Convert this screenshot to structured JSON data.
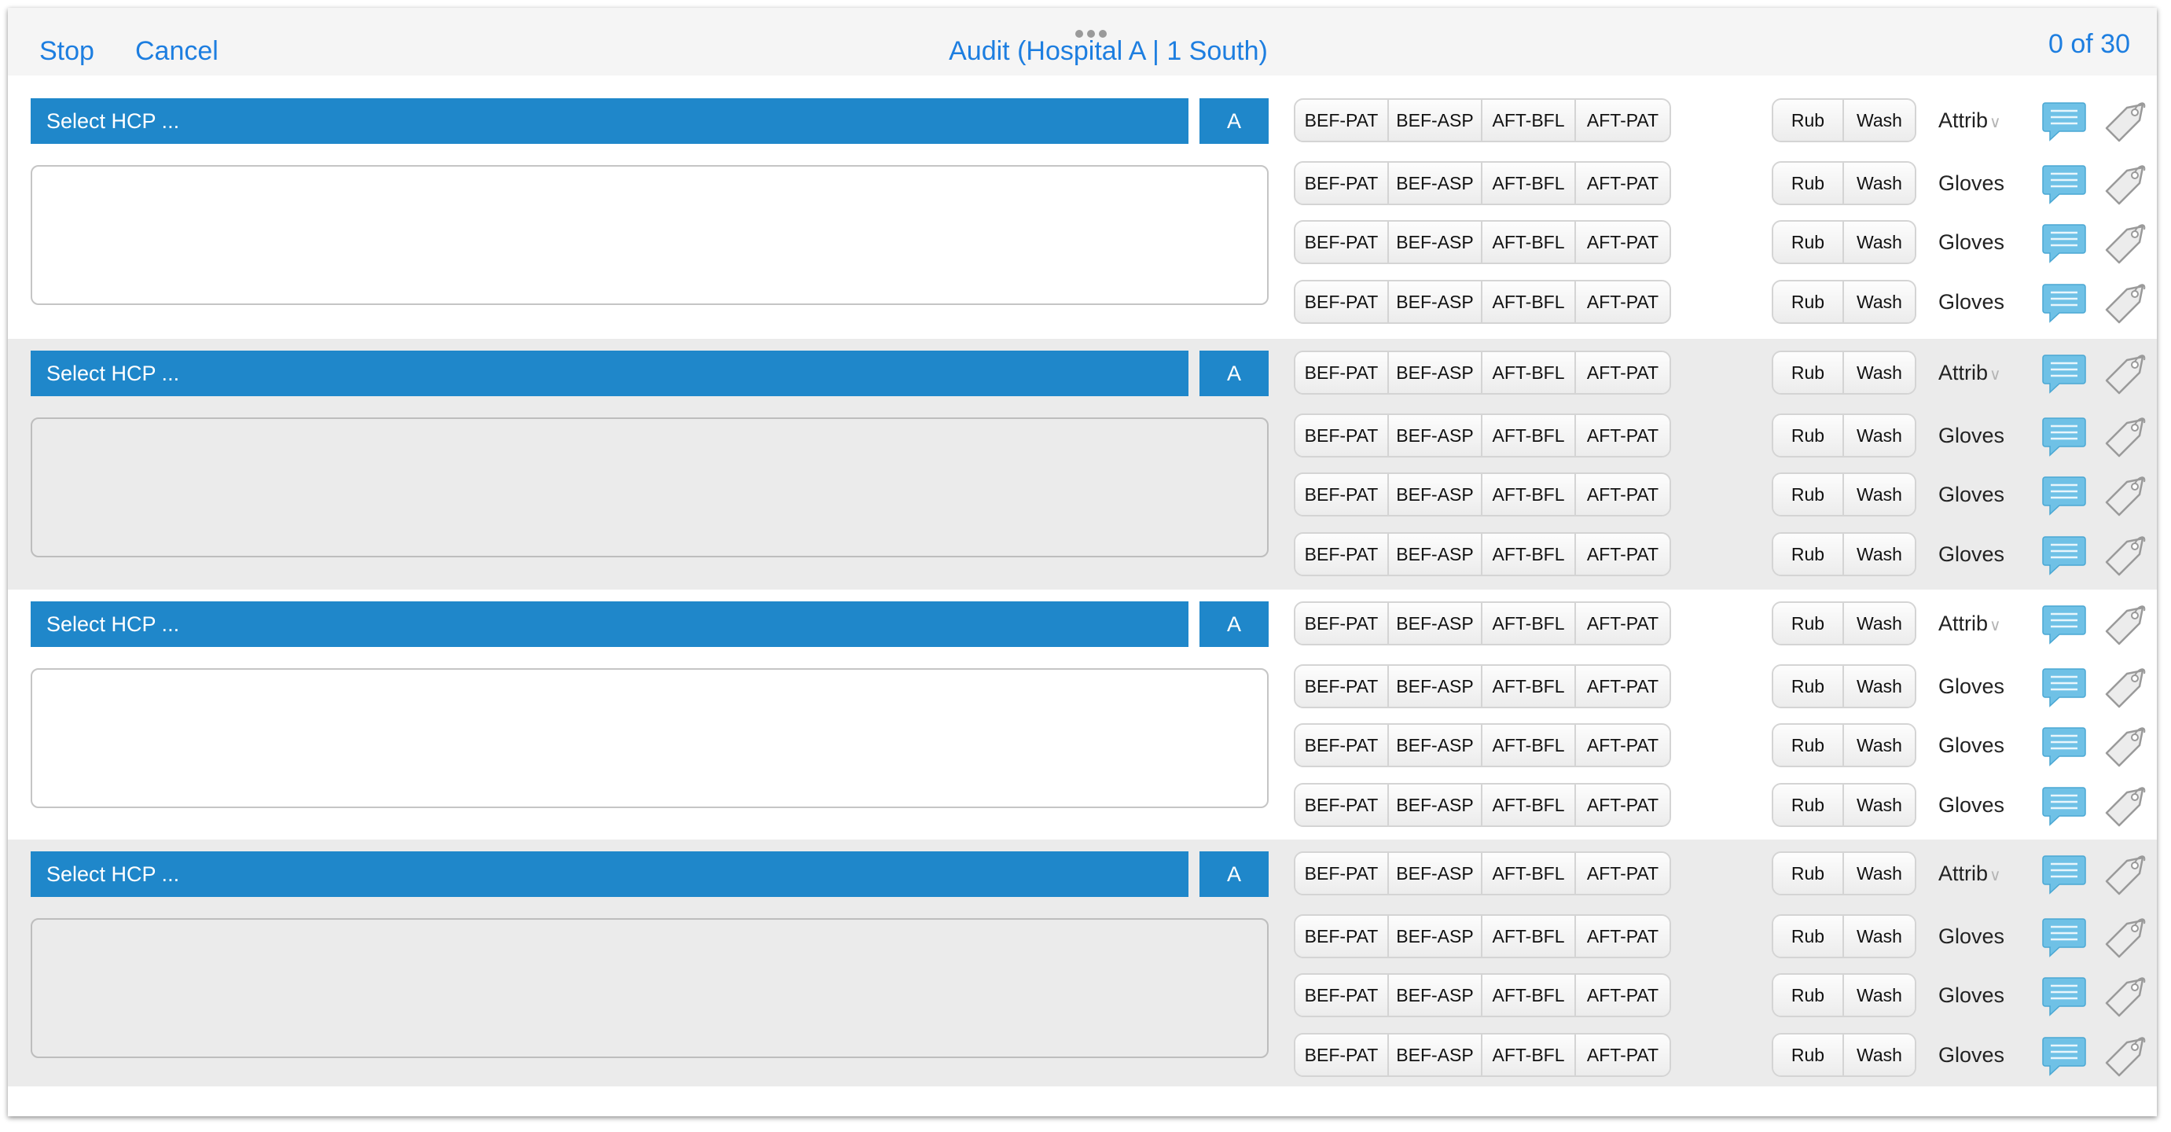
{
  "header": {
    "stop": "Stop",
    "cancel": "Cancel",
    "title": "Audit (Hospital A | 1 South)",
    "counter": "0 of 30"
  },
  "groups": [
    {
      "hcp_placeholder": "Select HCP ...",
      "a_label": "A",
      "rows": [
        {
          "moments": [
            "BEF-PAT",
            "BEF-ASP",
            "AFT-BFL",
            "AFT-PAT"
          ],
          "hygiene": [
            "Rub",
            "Wash"
          ],
          "type": "Attrib"
        },
        {
          "moments": [
            "BEF-PAT",
            "BEF-ASP",
            "AFT-BFL",
            "AFT-PAT"
          ],
          "hygiene": [
            "Rub",
            "Wash"
          ],
          "type": "Gloves"
        },
        {
          "moments": [
            "BEF-PAT",
            "BEF-ASP",
            "AFT-BFL",
            "AFT-PAT"
          ],
          "hygiene": [
            "Rub",
            "Wash"
          ],
          "type": "Gloves"
        },
        {
          "moments": [
            "BEF-PAT",
            "BEF-ASP",
            "AFT-BFL",
            "AFT-PAT"
          ],
          "hygiene": [
            "Rub",
            "Wash"
          ],
          "type": "Gloves"
        }
      ]
    },
    {
      "hcp_placeholder": "Select HCP ...",
      "a_label": "A",
      "rows": [
        {
          "moments": [
            "BEF-PAT",
            "BEF-ASP",
            "AFT-BFL",
            "AFT-PAT"
          ],
          "hygiene": [
            "Rub",
            "Wash"
          ],
          "type": "Attrib"
        },
        {
          "moments": [
            "BEF-PAT",
            "BEF-ASP",
            "AFT-BFL",
            "AFT-PAT"
          ],
          "hygiene": [
            "Rub",
            "Wash"
          ],
          "type": "Gloves"
        },
        {
          "moments": [
            "BEF-PAT",
            "BEF-ASP",
            "AFT-BFL",
            "AFT-PAT"
          ],
          "hygiene": [
            "Rub",
            "Wash"
          ],
          "type": "Gloves"
        },
        {
          "moments": [
            "BEF-PAT",
            "BEF-ASP",
            "AFT-BFL",
            "AFT-PAT"
          ],
          "hygiene": [
            "Rub",
            "Wash"
          ],
          "type": "Gloves"
        }
      ]
    },
    {
      "hcp_placeholder": "Select HCP ...",
      "a_label": "A",
      "rows": [
        {
          "moments": [
            "BEF-PAT",
            "BEF-ASP",
            "AFT-BFL",
            "AFT-PAT"
          ],
          "hygiene": [
            "Rub",
            "Wash"
          ],
          "type": "Attrib"
        },
        {
          "moments": [
            "BEF-PAT",
            "BEF-ASP",
            "AFT-BFL",
            "AFT-PAT"
          ],
          "hygiene": [
            "Rub",
            "Wash"
          ],
          "type": "Gloves"
        },
        {
          "moments": [
            "BEF-PAT",
            "BEF-ASP",
            "AFT-BFL",
            "AFT-PAT"
          ],
          "hygiene": [
            "Rub",
            "Wash"
          ],
          "type": "Gloves"
        },
        {
          "moments": [
            "BEF-PAT",
            "BEF-ASP",
            "AFT-BFL",
            "AFT-PAT"
          ],
          "hygiene": [
            "Rub",
            "Wash"
          ],
          "type": "Gloves"
        }
      ]
    },
    {
      "hcp_placeholder": "Select HCP ...",
      "a_label": "A",
      "rows": [
        {
          "moments": [
            "BEF-PAT",
            "BEF-ASP",
            "AFT-BFL",
            "AFT-PAT"
          ],
          "hygiene": [
            "Rub",
            "Wash"
          ],
          "type": "Attrib"
        },
        {
          "moments": [
            "BEF-PAT",
            "BEF-ASP",
            "AFT-BFL",
            "AFT-PAT"
          ],
          "hygiene": [
            "Rub",
            "Wash"
          ],
          "type": "Gloves"
        },
        {
          "moments": [
            "BEF-PAT",
            "BEF-ASP",
            "AFT-BFL",
            "AFT-PAT"
          ],
          "hygiene": [
            "Rub",
            "Wash"
          ],
          "type": "Gloves"
        },
        {
          "moments": [
            "BEF-PAT",
            "BEF-ASP",
            "AFT-BFL",
            "AFT-PAT"
          ],
          "hygiene": [
            "Rub",
            "Wash"
          ],
          "type": "Gloves"
        }
      ]
    }
  ],
  "icons": {
    "note": "speech-bubble-icon",
    "tag": "tag-icon",
    "dropdown": "chevron-down-icon"
  },
  "colors": {
    "accent": "#1f87ca",
    "link": "#1d7ee0",
    "note_icon": "#6fc1e6",
    "shaded_bg": "#ebebeb"
  }
}
